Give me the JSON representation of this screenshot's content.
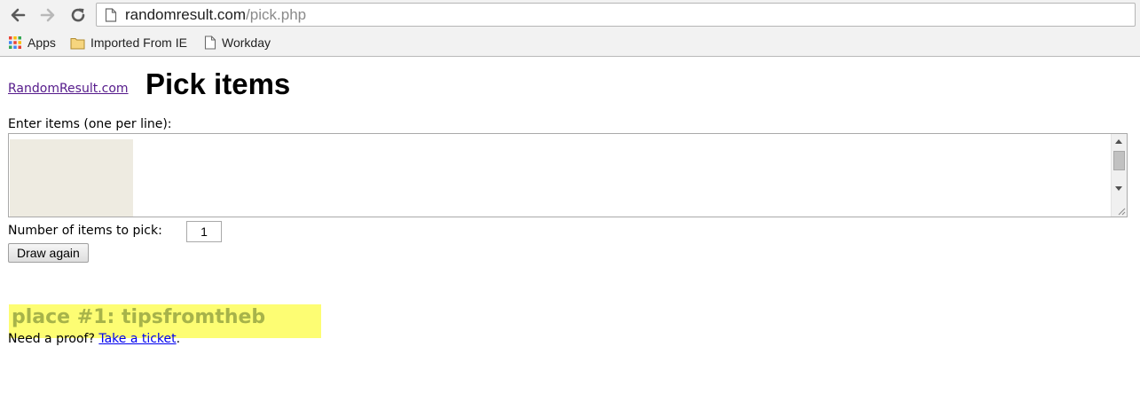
{
  "browser": {
    "url_host": "randomresult.com",
    "url_path": "/pick.php",
    "icons": {
      "back": "back-arrow-icon",
      "forward": "forward-arrow-icon",
      "reload": "reload-icon",
      "page": "page-icon"
    },
    "bookmarks": [
      {
        "label": "Apps",
        "icon": "apps-grid-icon"
      },
      {
        "label": "Imported From IE",
        "icon": "folder-icon"
      },
      {
        "label": "Workday",
        "icon": "page-icon"
      }
    ]
  },
  "page": {
    "site_link": "RandomResult.com",
    "title": "Pick items",
    "items_label": "Enter items (one per line):",
    "items_value": "",
    "pick_label": "Number of items to pick:",
    "pick_count": "1",
    "draw_button": "Draw again",
    "result_text": "place #1: tipsfromtheb",
    "proof_prefix": "Need a proof?",
    "proof_link": "Take a ticket",
    "proof_suffix": "."
  },
  "colors": {
    "link_visited": "#551a8b",
    "link": "#0000ee",
    "result_highlight": "#fdfd73",
    "result_text": "#a7b34a"
  }
}
